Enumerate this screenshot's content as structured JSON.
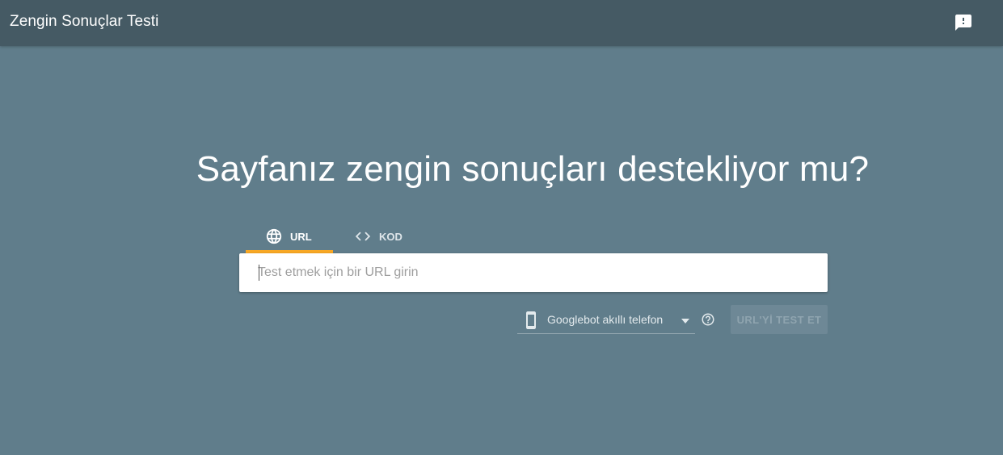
{
  "header": {
    "title": "Zengin Sonuçlar Testi",
    "feedback_icon": "feedback-icon"
  },
  "main": {
    "headline": "Sayfanız zengin sonuçları destekliyor mu?",
    "tabs": [
      {
        "label": "URL",
        "icon": "globe-icon",
        "selected": true
      },
      {
        "label": "KOD",
        "icon": "code-icon",
        "selected": false
      }
    ],
    "url_input": {
      "placeholder": "Test etmek için bir URL girin",
      "value": ""
    },
    "device_select": {
      "icon": "smartphone-icon",
      "selected": "Googlebot akıllı telefon"
    },
    "test_button_label": "URL'Yİ TEST ET"
  },
  "colors": {
    "background": "#607d8b",
    "header": "#455a64",
    "tab_indicator": "#f9a825",
    "input_background": "#ffffff",
    "button_disabled": "#6e8896"
  }
}
